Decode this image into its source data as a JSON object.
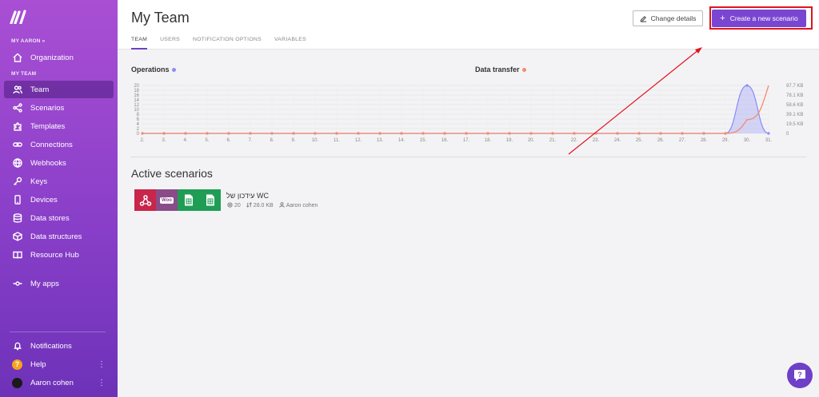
{
  "sidebar": {
    "org_section_label": "MY AARON »",
    "team_section_label": "MY TEAM",
    "items": [
      {
        "label": "Organization",
        "icon": "home-icon"
      },
      {
        "label": "Team",
        "icon": "users-icon"
      },
      {
        "label": "Scenarios",
        "icon": "share-icon"
      },
      {
        "label": "Templates",
        "icon": "puzzle-icon"
      },
      {
        "label": "Connections",
        "icon": "link-icon"
      },
      {
        "label": "Webhooks",
        "icon": "globe-icon"
      },
      {
        "label": "Keys",
        "icon": "key-icon"
      },
      {
        "label": "Devices",
        "icon": "phone-icon"
      },
      {
        "label": "Data stores",
        "icon": "database-icon"
      },
      {
        "label": "Data structures",
        "icon": "cube-icon"
      },
      {
        "label": "Resource Hub",
        "icon": "book-icon"
      },
      {
        "label": "My apps",
        "icon": "commit-icon"
      }
    ],
    "bottom": {
      "notifications": "Notifications",
      "help": "Help",
      "user": "Aaron cohen"
    },
    "active_item": "Team"
  },
  "header": {
    "title": "My Team",
    "tabs": [
      "TEAM",
      "USERS",
      "NOTIFICATION OPTIONS",
      "VARIABLES"
    ],
    "active_tab": "TEAM",
    "change_details_label": "Change details",
    "create_label": "Create a new scenario"
  },
  "chart_data": [
    {
      "type": "area",
      "title": "Operations",
      "color": "#8b8cf5",
      "x": [
        "2.",
        "3.",
        "4.",
        "5.",
        "6.",
        "7.",
        "8.",
        "9.",
        "10.",
        "11.",
        "12.",
        "13.",
        "14.",
        "15.",
        "16.",
        "17.",
        "18.",
        "19.",
        "20.",
        "21.",
        "22.",
        "23.",
        "24.",
        "25.",
        "26.",
        "27.",
        "28.",
        "29.",
        "30.",
        "31."
      ],
      "values": [
        0,
        0,
        0,
        0,
        0,
        0,
        0,
        0,
        0,
        0,
        0,
        0,
        0,
        0,
        0,
        0,
        0,
        0,
        0,
        0,
        0,
        0,
        0,
        0,
        0,
        0,
        0,
        0,
        20,
        0
      ],
      "yticks": [
        "20",
        "18",
        "16",
        "14",
        "12",
        "10",
        "8",
        "6",
        "4",
        "2",
        "0"
      ],
      "ylim": [
        0,
        20
      ]
    },
    {
      "type": "line",
      "title": "Data transfer",
      "color": "#f58a6c",
      "x": [
        "2.",
        "3.",
        "4.",
        "5.",
        "6.",
        "7.",
        "8.",
        "9.",
        "10.",
        "11.",
        "12.",
        "13.",
        "14.",
        "15.",
        "16.",
        "17.",
        "18.",
        "19.",
        "20.",
        "21.",
        "22.",
        "23.",
        "24.",
        "25.",
        "26.",
        "27.",
        "28.",
        "29.",
        "30.",
        "31."
      ],
      "values": [
        0,
        0,
        0,
        0,
        0,
        0,
        0,
        0,
        0,
        0,
        0,
        0,
        0,
        0,
        0,
        0,
        0,
        0,
        0,
        0,
        0,
        0,
        0,
        0,
        0,
        0,
        0,
        0,
        28,
        97.7
      ],
      "unit": "KB",
      "yticks": [
        "97.7 KB",
        "78.1 KB",
        "58.6 KB",
        "39.1 KB",
        "19.5 KB",
        "0"
      ],
      "ylim": [
        0,
        97.7
      ]
    }
  ],
  "active_scenarios": {
    "title": "Active scenarios",
    "items": [
      {
        "name": "עידכון של WC",
        "operations": "20",
        "data": "28.0 KB",
        "owner": "Aaron cohen",
        "apps": [
          {
            "icon": "webhook-icon",
            "color": "#c8264a"
          },
          {
            "icon": "woo-icon",
            "color": "#8a4c89",
            "text": "Woo"
          },
          {
            "icon": "sheets-icon",
            "color": "#1f9d55"
          },
          {
            "icon": "sheets-icon",
            "color": "#1f9d55"
          }
        ]
      }
    ]
  },
  "colors": {
    "accent": "#7a46d1",
    "highlight": "#e0141e"
  }
}
